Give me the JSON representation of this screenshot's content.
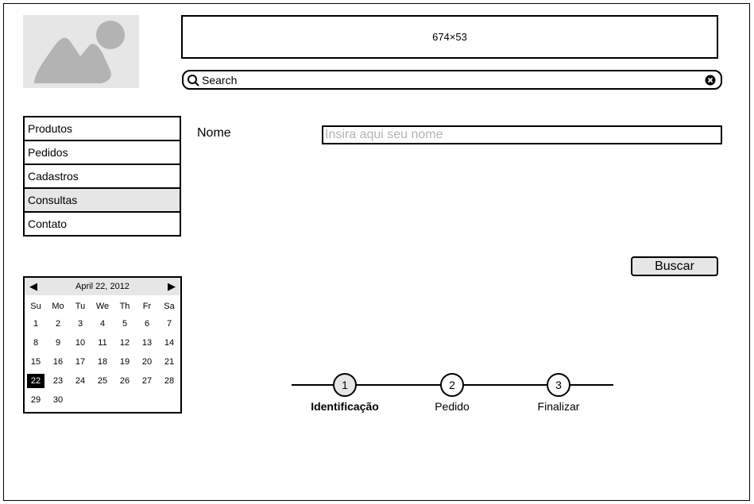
{
  "header": {
    "placeholder_label": "674×53"
  },
  "search": {
    "placeholder": "Search"
  },
  "nav": {
    "items": [
      {
        "label": "Produtos",
        "active": false
      },
      {
        "label": "Pedidos",
        "active": false
      },
      {
        "label": "Cadastros",
        "active": false
      },
      {
        "label": "Consultas",
        "active": true
      },
      {
        "label": "Contato",
        "active": false
      }
    ]
  },
  "calendar": {
    "title": "April 22, 2012",
    "prev_icon": "triangle-left-icon",
    "next_icon": "triangle-right-icon",
    "weekdays": [
      "Su",
      "Mo",
      "Tu",
      "We",
      "Th",
      "Fr",
      "Sa"
    ],
    "days": [
      "1",
      "2",
      "3",
      "4",
      "5",
      "6",
      "7",
      "8",
      "9",
      "10",
      "11",
      "12",
      "13",
      "14",
      "15",
      "16",
      "17",
      "18",
      "19",
      "20",
      "21",
      "22",
      "23",
      "24",
      "25",
      "26",
      "27",
      "28",
      "29",
      "30"
    ],
    "selected": "22"
  },
  "form": {
    "name_label": "Nome",
    "name_placeholder": "Insira aqui seu nome",
    "search_button": "Buscar"
  },
  "stepper": {
    "steps": [
      {
        "number": "1",
        "label": "Identificação",
        "current": true
      },
      {
        "number": "2",
        "label": "Pedido",
        "current": false
      },
      {
        "number": "3",
        "label": "Finalizar",
        "current": false
      }
    ]
  },
  "colors": {
    "placeholder_fill": "#e6e6e6",
    "placeholder_shape": "#b3b3b3",
    "border": "#000000"
  }
}
